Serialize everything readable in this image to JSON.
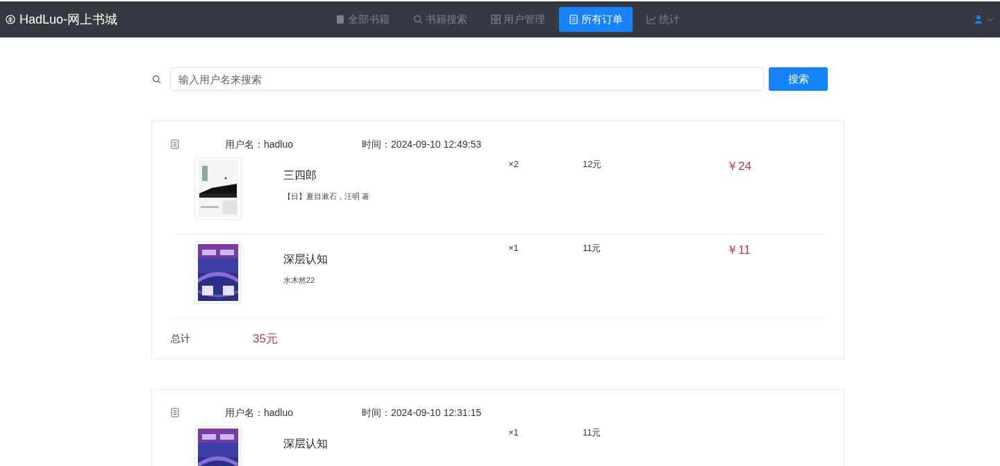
{
  "header": {
    "logo_text": "HadLuo-网上书城",
    "nav": [
      {
        "label": "全部书籍",
        "selected": false
      },
      {
        "label": "书籍搜索",
        "selected": false
      },
      {
        "label": "用户管理",
        "selected": false
      },
      {
        "label": "所有订单",
        "selected": true
      },
      {
        "label": "统计",
        "selected": false
      }
    ]
  },
  "search": {
    "placeholder": "输入用户名来搜索",
    "button": "搜索"
  },
  "orders": [
    {
      "user": "用户名：hadluo",
      "time": "时间：2024-09-10 12:49:53",
      "items": [
        {
          "title": "三四郎",
          "author": "【日】夏目漱石，汪明 著",
          "qty": "×2",
          "price": "12元",
          "subtotal": "￥24"
        },
        {
          "title": "深层认知",
          "author": "水木然22",
          "qty": "×1",
          "price": "11元",
          "subtotal": "￥11"
        }
      ],
      "total_label": "总计",
      "total": "35元"
    },
    {
      "user": "用户名：hadluo",
      "time": "时间：2024-09-10 12:31:15",
      "items": [
        {
          "title": "深层认知",
          "qty": "×1",
          "price": "11元"
        }
      ]
    }
  ]
}
